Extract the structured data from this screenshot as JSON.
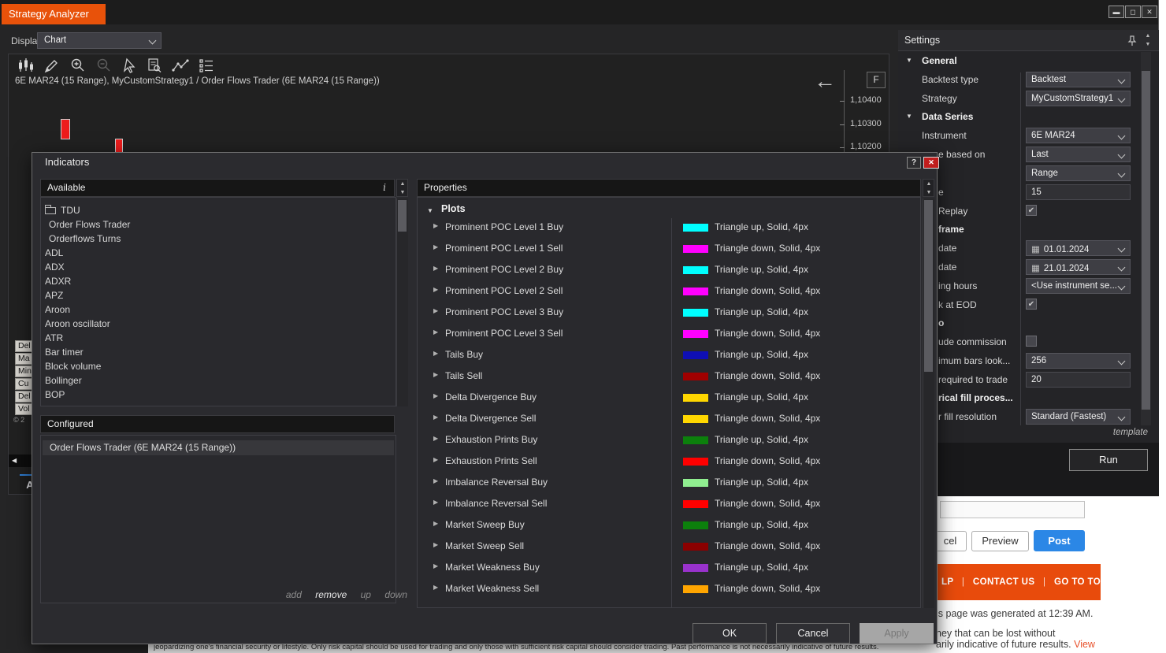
{
  "window": {
    "title": "Strategy Analyzer",
    "controls": {
      "minimize": "minimize",
      "maximize": "maximize",
      "close": "close"
    }
  },
  "display": {
    "label": "Display",
    "value": "Chart"
  },
  "icons": {
    "toolbar": [
      "candlestick-chart-icon",
      "draw-pencil-icon",
      "zoom-in-icon",
      "zoom-out-icon",
      "cursor-icon",
      "report-search-icon",
      "polyline-icon",
      "list-properties-icon"
    ],
    "back_arrow": "←",
    "calendar": "▦",
    "check": "✔"
  },
  "chart": {
    "series_label": "6E MAR24 (15 Range), MyCustomStrategy1 /  Order Flows Trader (6E MAR24 (15 Range))",
    "price_ticks": [
      "1,10400",
      "1,10300",
      "1,10200"
    ],
    "f_button": "F",
    "databox_fragments": [
      "Del",
      "Ma",
      "Min",
      "Cu",
      "Del",
      "Vol"
    ],
    "copyright_fragment": "© 2",
    "scroll_left_button": "◀",
    "tab_fragment": "A"
  },
  "settings": {
    "title": "Settings",
    "rows": [
      {
        "type": "section",
        "label": "General",
        "arrow": true
      },
      {
        "type": "dropdown",
        "label": "Backtest type",
        "value": "Backtest"
      },
      {
        "type": "dropdown",
        "label": "Strategy",
        "value": "MyCustomStrategy1"
      },
      {
        "type": "section",
        "label": "Data Series",
        "arrow": true
      },
      {
        "type": "dropdown",
        "label": "Instrument",
        "value": "6E MAR24"
      },
      {
        "type": "dropdown",
        "label": "e based on",
        "value": "Last",
        "frag": true
      },
      {
        "type": "dropdown",
        "label": "",
        "value": "Range",
        "frag": true
      },
      {
        "type": "input",
        "label": "e",
        "value": "15",
        "frag": true
      },
      {
        "type": "checkbox",
        "label": "Replay",
        "checked": true,
        "frag": true
      },
      {
        "type": "section",
        "label": "frame",
        "frag": true
      },
      {
        "type": "dropdown",
        "label": "date",
        "value": "01.01.2024",
        "cal": true,
        "frag": true
      },
      {
        "type": "dropdown",
        "label": "date",
        "value": "21.01.2024",
        "cal": true,
        "frag": true
      },
      {
        "type": "dropdown",
        "label": "ing hours",
        "value": "<Use instrument se...",
        "frag": true
      },
      {
        "type": "checkbox",
        "label": "k at EOD",
        "checked": true,
        "frag": true
      },
      {
        "type": "section",
        "label": "o",
        "frag": true
      },
      {
        "type": "checkbox",
        "label": "ude commission",
        "checked": false,
        "frag": true
      },
      {
        "type": "dropdown",
        "label": "imum bars look...",
        "value": "256",
        "frag": true
      },
      {
        "type": "input",
        "label": " required to trade",
        "value": "20",
        "frag": true
      },
      {
        "type": "section",
        "label": "rical fill proces...",
        "frag": true
      },
      {
        "type": "dropdown",
        "label": "r fill resolution",
        "value": "Standard (Fastest)",
        "frag": true
      }
    ],
    "template_link": "template",
    "run_button": "Run"
  },
  "dialog": {
    "title": "Indicators",
    "help_button": "?",
    "close_button": "✕",
    "available": {
      "header": "Available",
      "info_icon": "i",
      "items": [
        {
          "label": "TDU",
          "kind": "folder"
        },
        {
          "label": "Order Flows Trader",
          "kind": "child"
        },
        {
          "label": "Orderflows Turns",
          "kind": "child"
        },
        {
          "label": "ADL",
          "kind": "item"
        },
        {
          "label": "ADX",
          "kind": "item"
        },
        {
          "label": "ADXR",
          "kind": "item"
        },
        {
          "label": "APZ",
          "kind": "item"
        },
        {
          "label": "Aroon",
          "kind": "item"
        },
        {
          "label": "Aroon oscillator",
          "kind": "item"
        },
        {
          "label": "ATR",
          "kind": "item"
        },
        {
          "label": "Bar timer",
          "kind": "item"
        },
        {
          "label": "Block volume",
          "kind": "item"
        },
        {
          "label": "Bollinger",
          "kind": "item"
        },
        {
          "label": "BOP",
          "kind": "item"
        }
      ]
    },
    "configured": {
      "header": "Configured",
      "items": [
        "Order Flows Trader (6E MAR24 (15 Range))"
      ]
    },
    "actions": {
      "add": "add",
      "remove": "remove",
      "up": "up",
      "down": "down"
    },
    "properties": {
      "header": "Properties",
      "section": "Plots",
      "plots": [
        {
          "name": "Prominent POC Level 1 Buy",
          "color": "#00ffff",
          "style": "Triangle up, Solid, 4px"
        },
        {
          "name": "Prominent POC Level 1 Sell",
          "color": "#ff00ff",
          "style": "Triangle down, Solid, 4px"
        },
        {
          "name": "Prominent POC Level 2 Buy",
          "color": "#00ffff",
          "style": "Triangle up, Solid, 4px"
        },
        {
          "name": "Prominent POC Level 2 Sell",
          "color": "#ff00ff",
          "style": "Triangle down, Solid, 4px"
        },
        {
          "name": "Prominent POC Level 3 Buy",
          "color": "#00ffff",
          "style": "Triangle up, Solid, 4px"
        },
        {
          "name": "Prominent POC Level 3 Sell",
          "color": "#ff00ff",
          "style": "Triangle down, Solid, 4px"
        },
        {
          "name": "Tails Buy",
          "color": "#0f0fb4",
          "style": "Triangle up, Solid, 4px"
        },
        {
          "name": "Tails Sell",
          "color": "#a00000",
          "style": "Triangle down, Solid, 4px"
        },
        {
          "name": "Delta Divergence Buy",
          "color": "#ffd700",
          "style": "Triangle up, Solid, 4px"
        },
        {
          "name": "Delta Divergence Sell",
          "color": "#ffd700",
          "style": "Triangle down, Solid, 4px"
        },
        {
          "name": "Exhaustion Prints Buy",
          "color": "#0c800c",
          "style": "Triangle up, Solid, 4px"
        },
        {
          "name": "Exhaustion Prints Sell",
          "color": "#ff0000",
          "style": "Triangle down, Solid, 4px"
        },
        {
          "name": "Imbalance Reversal Buy",
          "color": "#90ee90",
          "style": "Triangle up, Solid, 4px"
        },
        {
          "name": "Imbalance Reversal Sell",
          "color": "#ff0000",
          "style": "Triangle down, Solid, 4px"
        },
        {
          "name": "Market Sweep Buy",
          "color": "#0c800c",
          "style": "Triangle up, Solid, 4px"
        },
        {
          "name": "Market Sweep Sell",
          "color": "#8b0000",
          "style": "Triangle down, Solid, 4px"
        },
        {
          "name": "Market Weakness Buy",
          "color": "#9932cc",
          "style": "Triangle up, Solid, 4px"
        },
        {
          "name": "Market Weakness Sell",
          "color": "#ffa500",
          "style": "Triangle down, Solid, 4px"
        }
      ]
    },
    "buttons": {
      "ok": "OK",
      "cancel": "Cancel",
      "apply": "Apply"
    }
  },
  "webpage": {
    "cancel_fragment": "cel",
    "preview_button": "Preview",
    "post_button": "Post",
    "footer_links": [
      "LP",
      "CONTACT US",
      "GO TO TOP"
    ],
    "generated_line": "is page was generated at 12:39 AM.",
    "risk_line1": "ney that can be lost without",
    "risk_line2": "arily indicative of future results. ",
    "view_link": "View",
    "disclaimer": "jeopardizing one's financial security or lifestyle. Only risk capital should be used for trading and only those with sufficient risk capital should consider trading. Past performance is not necessarily indicative of future results."
  },
  "colors": {
    "accent_orange": "#e8520a",
    "webpage_orange": "#e84b0c",
    "post_blue": "#2b87e6",
    "candle_red": "#ed1c1c",
    "link_red": "#e8502a"
  }
}
